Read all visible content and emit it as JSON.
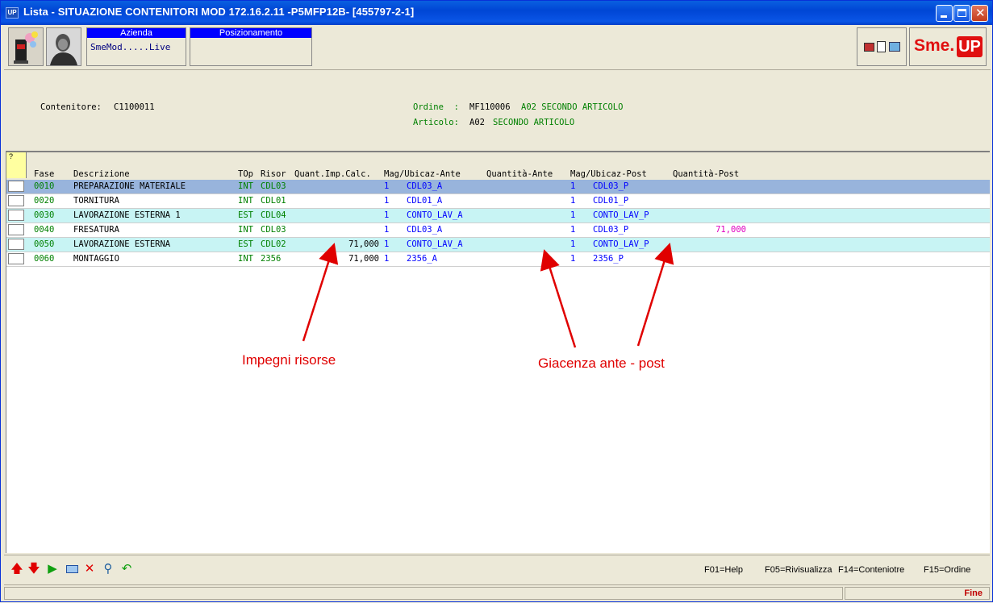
{
  "window": {
    "app_icon": "UP",
    "title": "Lista - SITUAZIONE CONTENITORI MOD 172.16.2.11 -P5MFP12B- [455797-2-1]"
  },
  "toolbar": {
    "azienda_label": "Azienda",
    "azienda_value": "SmeMod.....Live",
    "posizionamento_label": "Posizionamento",
    "posizionamento_value": "",
    "logo_text": "Sme.",
    "logo_badge": "UP"
  },
  "info": {
    "contenitore_label": "Contenitore:",
    "contenitore_value": "C1100011",
    "ordine_label": "Ordine  :",
    "ordine_code": "MF110006",
    "ordine_desc": "A02 SECONDO ARTICOLO",
    "articolo_label": "Articolo:",
    "articolo_code": "A02",
    "articolo_desc": "SECONDO ARTICOLO"
  },
  "grid": {
    "corner_label": "?",
    "columns": [
      "Fase",
      "Descrizione",
      "TOp",
      "Risor",
      "Quant.Imp.Calc.",
      "Mag/Ubicaz-Ante",
      "Quantità-Ante",
      "Mag/Ubicaz-Post",
      "Quantità-Post"
    ],
    "rows": [
      {
        "fase": "0010",
        "descr": "PREPARAZIONE MATERIALE",
        "top": "INT",
        "risor": "CDL03",
        "qimp": "",
        "mag_ante": "1",
        "ubic_ante": "CDL03_A",
        "q_ante": "",
        "mag_post": "1",
        "ubic_post": "CDL03_P",
        "q_post": ""
      },
      {
        "fase": "0020",
        "descr": "TORNITURA",
        "top": "INT",
        "risor": "CDL01",
        "qimp": "",
        "mag_ante": "1",
        "ubic_ante": "CDL01_A",
        "q_ante": "",
        "mag_post": "1",
        "ubic_post": "CDL01_P",
        "q_post": ""
      },
      {
        "fase": "0030",
        "descr": "LAVORAZIONE ESTERNA 1",
        "top": "EST",
        "risor": "CDL04",
        "qimp": "",
        "mag_ante": "1",
        "ubic_ante": "CONTO_LAV_A",
        "q_ante": "",
        "mag_post": "1",
        "ubic_post": "CONTO_LAV_P",
        "q_post": ""
      },
      {
        "fase": "0040",
        "descr": "FRESATURA",
        "top": "INT",
        "risor": "CDL03",
        "qimp": "",
        "mag_ante": "1",
        "ubic_ante": "CDL03_A",
        "q_ante": "",
        "mag_post": "1",
        "ubic_post": "CDL03_P",
        "q_post": "71,000"
      },
      {
        "fase": "0050",
        "descr": "LAVORAZIONE ESTERNA",
        "top": "EST",
        "risor": "CDL02",
        "qimp": "71,000",
        "mag_ante": "1",
        "ubic_ante": "CONTO_LAV_A",
        "q_ante": "",
        "mag_post": "1",
        "ubic_post": "CONTO_LAV_P",
        "q_post": ""
      },
      {
        "fase": "0060",
        "descr": "MONTAGGIO",
        "top": "INT",
        "risor": "2356",
        "qimp": "71,000",
        "mag_ante": "1",
        "ubic_ante": "2356_A",
        "q_ante": "",
        "mag_post": "1",
        "ubic_post": "2356_P",
        "q_post": ""
      }
    ],
    "row_colors": [
      "#98b4dc",
      "#ffffff",
      "#c8f4f4",
      "#ffffff",
      "#c8f4f4",
      "#ffffff"
    ]
  },
  "annotations": {
    "impegni": "Impegni risorse",
    "giacenza": "Giacenza ante - post",
    "color": "#e00000"
  },
  "bottom": {
    "icons": [
      "arrow-up-icon",
      "arrow-down-icon",
      "play-icon",
      "window-icon",
      "delete-icon",
      "search-icon",
      "refresh-icon"
    ],
    "fkeys": [
      "F01=Help",
      "F05=Rivisualizza",
      "F14=Conteniotre",
      "F15=Ordine"
    ]
  },
  "status": {
    "text": "Fine"
  }
}
